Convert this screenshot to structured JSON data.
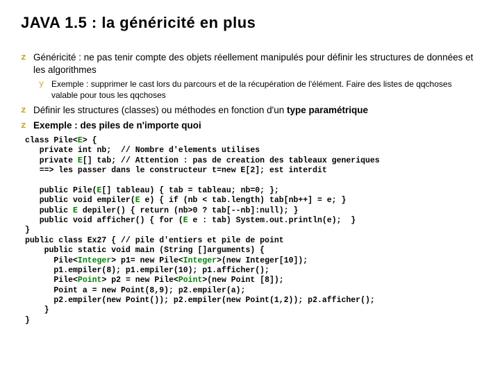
{
  "title": "JAVA 1.5 : la généricité en plus",
  "bullets": {
    "b1": "Généricité : ne pas tenir compte des objets réellement manipulés pour définir les structures de données et les algorithmes",
    "b1_sub": "Exemple : supprimer le cast lors du parcours et de la récupération de l'élément. Faire des listes de qqchoses valable pour tous les qqchoses",
    "b2_a": "Définir les structures (classes) ou méthodes en fonction d'un ",
    "b2_b": "type paramétrique",
    "b3": "Exemple : des piles de n'importe quoi"
  },
  "code": {
    "l01a": "class Pile<",
    "l01b": "E",
    "l01c": "> {",
    "l02": "   private int nb;  // Nombre d'elements utilises",
    "l03a": "   private ",
    "l03b": "E",
    "l03c": "[] tab; // Attention : pas de creation des tableaux generiques",
    "l04": "   ==> les passer dans le constructeur t=new E[2]; est interdit",
    "l05": "",
    "l06a": "   public Pile(",
    "l06b": "E",
    "l06c": "[] tableau) { tab = tableau; nb=0; };",
    "l07a": "   public void empiler(",
    "l07b": "E",
    "l07c": " e) { if (nb < tab.length) tab[nb++] = e; }",
    "l08a": "   public ",
    "l08b": "E",
    "l08c": " depiler() { return (nb>0 ? tab[--nb]:null); }",
    "l09a": "   public void afficher() { for (",
    "l09b": "E",
    "l09c": " e : tab) System.out.println(e);  }",
    "l10": "}",
    "l11": "public class Ex27 { // pile d'entiers et pile de point",
    "l12": "    public static void main (String []arguments) {",
    "l13a": "      Pile<",
    "l13b": "Integer",
    "l13c": "> p1= new Pile<",
    "l13d": "Integer",
    "l13e": ">(new Integer[10]);",
    "l14": "      p1.empiler(8); p1.empiler(10); p1.afficher();",
    "l15a": "      Pile<",
    "l15b": "Point",
    "l15c": "> p2 = new Pile<",
    "l15d": "Point",
    "l15e": ">(new Point [8]);",
    "l16": "      Point a = new Point(8,9); p2.empiler(a);",
    "l17": "      p2.empiler(new Point()); p2.empiler(new Point(1,2)); p2.afficher();",
    "l18": "    }",
    "l19": "}"
  }
}
